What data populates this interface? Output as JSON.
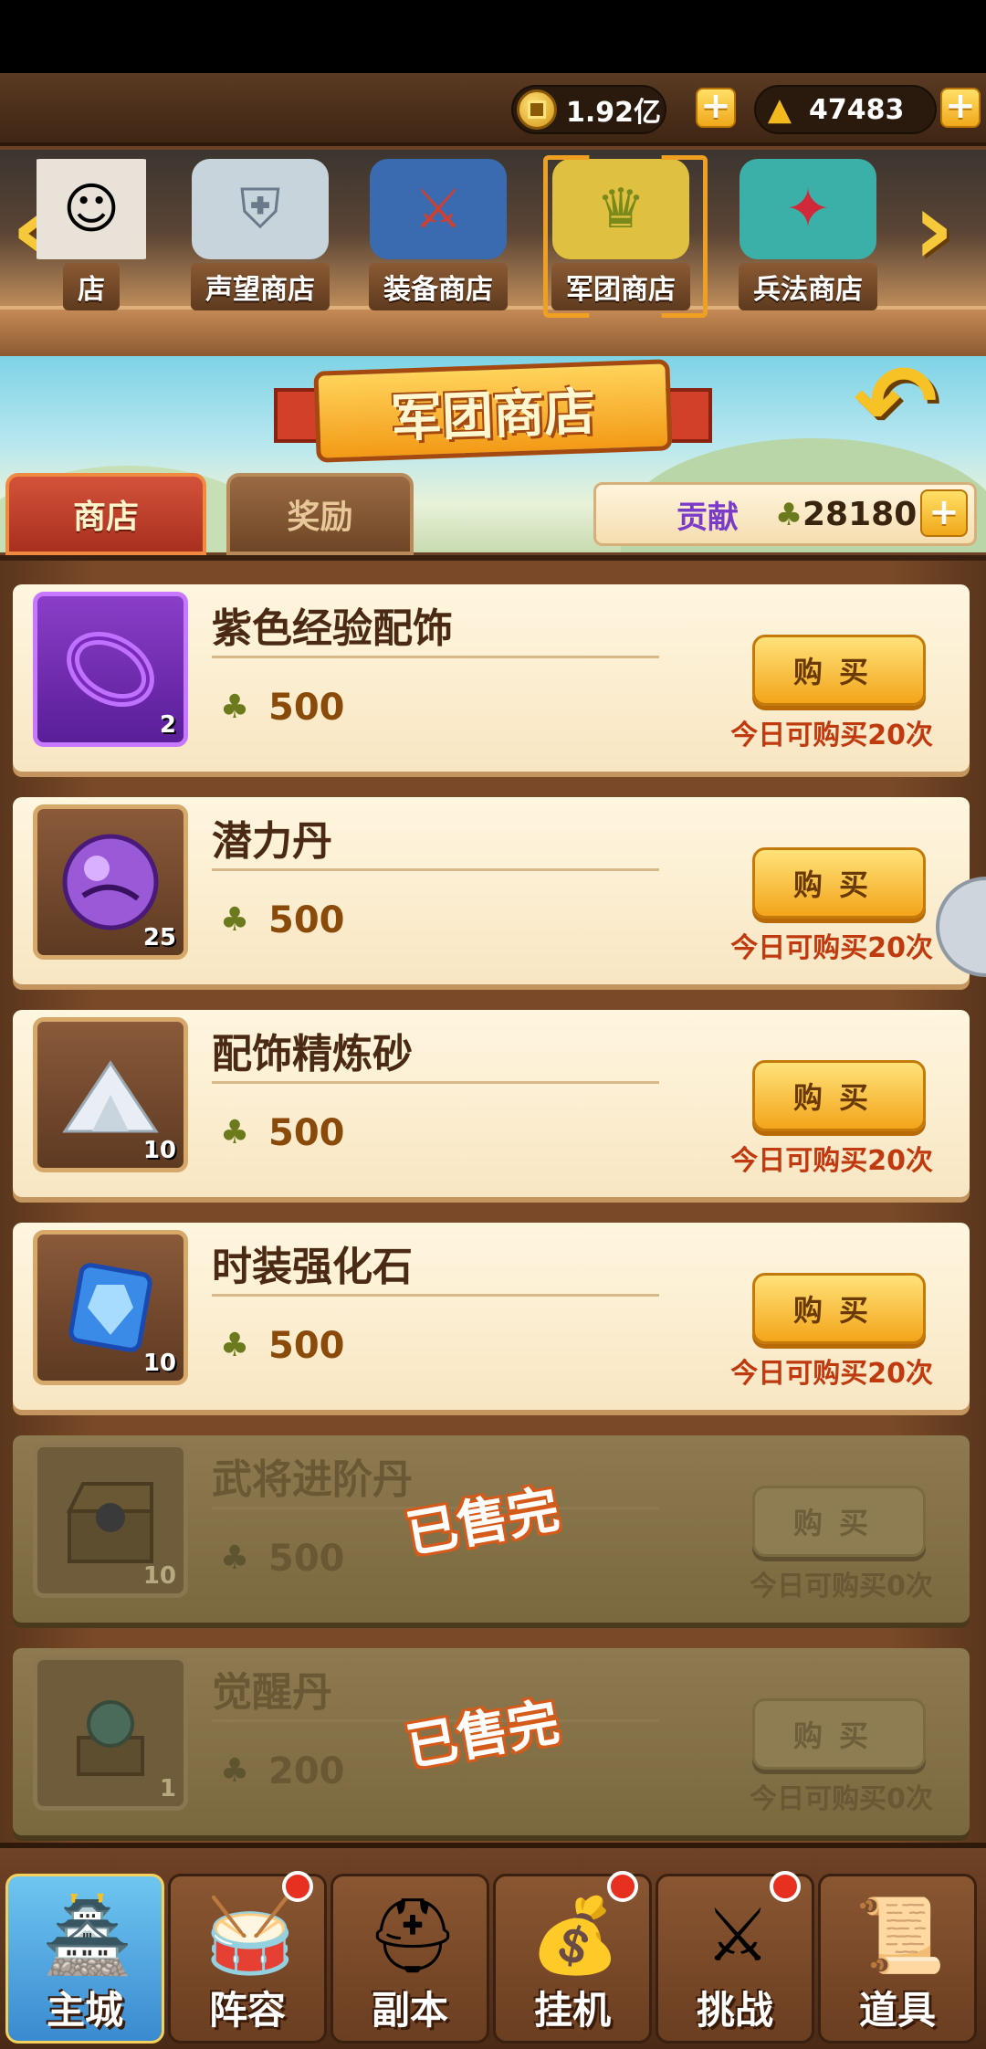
{
  "resources": {
    "coins": "1.92亿",
    "ingots": "47483"
  },
  "shop_tabs": [
    {
      "label": "店",
      "icon": "chef-icon"
    },
    {
      "label": "声望商店",
      "icon": "shield-icon"
    },
    {
      "label": "装备商店",
      "icon": "armor-icon"
    },
    {
      "label": "军团商店",
      "icon": "treasure-icon"
    },
    {
      "label": "兵法商店",
      "icon": "scroll-icon"
    }
  ],
  "banner": {
    "title": "军团商店"
  },
  "sub_tabs": {
    "shop": "商店",
    "reward": "奖励"
  },
  "contribution": {
    "label": "贡献",
    "value": "28180"
  },
  "items": [
    {
      "name": "紫色经验配饰",
      "count": "2",
      "price": "500",
      "button": "购买",
      "limit": "今日可购买20次",
      "sold_out": false
    },
    {
      "name": "潜力丹",
      "count": "25",
      "price": "500",
      "button": "购买",
      "limit": "今日可购买20次",
      "sold_out": false
    },
    {
      "name": "配饰精炼砂",
      "count": "10",
      "price": "500",
      "button": "购买",
      "limit": "今日可购买20次",
      "sold_out": false
    },
    {
      "name": "时装强化石",
      "count": "10",
      "price": "500",
      "button": "购买",
      "limit": "今日可购买20次",
      "sold_out": false
    },
    {
      "name": "武将进阶丹",
      "count": "10",
      "price": "500",
      "button": "购买",
      "limit": "今日可购买0次",
      "sold_out": true,
      "stamp": "已售完"
    },
    {
      "name": "觉醒丹",
      "count": "1",
      "price": "200",
      "button": "购买",
      "limit": "今日可购买0次",
      "sold_out": true,
      "stamp": "已售完"
    }
  ],
  "bottom_nav": [
    {
      "label": "主城",
      "badge": false
    },
    {
      "label": "阵容",
      "badge": true
    },
    {
      "label": "副本",
      "badge": false
    },
    {
      "label": "挂机",
      "badge": true
    },
    {
      "label": "挑战",
      "badge": true
    },
    {
      "label": "道具",
      "badge": false
    }
  ],
  "colors": {
    "accent_gold": "#f3a51a",
    "limit_red": "#c03a10",
    "contribution_purple": "#7a3cc8"
  }
}
